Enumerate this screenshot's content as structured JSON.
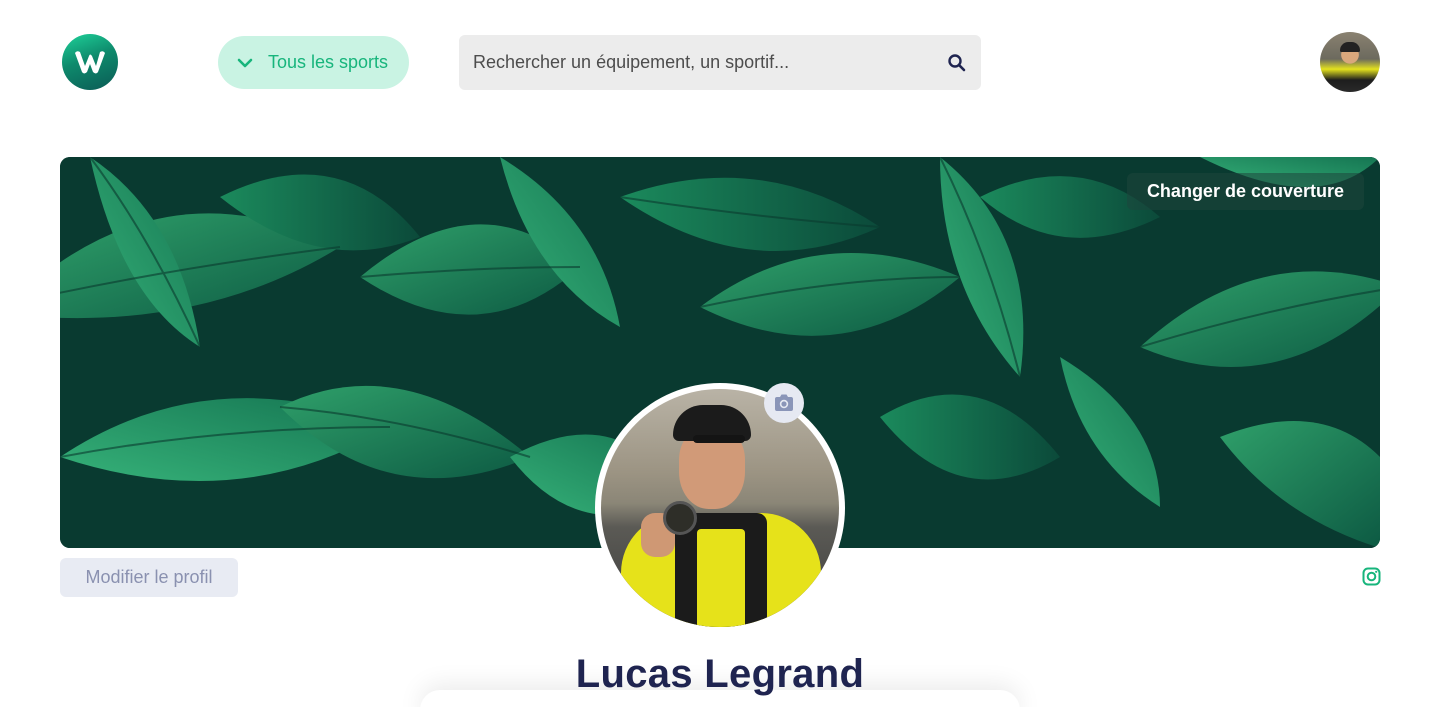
{
  "header": {
    "logo_icon": "w-logo-icon",
    "sports_button": {
      "label": "Tous les sports",
      "icon": "chevron-down-icon"
    },
    "search": {
      "placeholder": "Rechercher un équipement, un sportif...",
      "icon": "search-icon"
    },
    "user_avatar": "avatar"
  },
  "cover": {
    "change_label": "Changer de couverture"
  },
  "profile": {
    "name": "Lucas Legrand",
    "camera_icon": "camera-icon",
    "edit_label": "Modifier le profil",
    "social_icon": "instagram-icon"
  },
  "colors": {
    "brand_green": "#17b57c",
    "brand_green_light": "#c9f3e3",
    "navy": "#1f2450",
    "cover_dark": "#0a3d33"
  }
}
